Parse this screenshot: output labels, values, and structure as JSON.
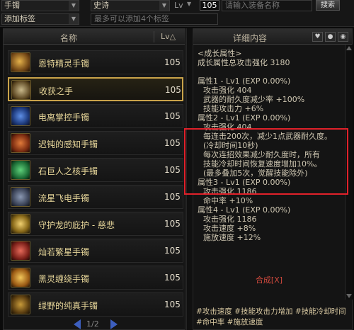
{
  "filters": {
    "type_select": "手镯",
    "rarity_select": "史诗",
    "lv_label": "Lv",
    "level_value": "105",
    "name_placeholder": "请输入装备名称",
    "search_label": "搜索",
    "tag_select": "添加标签",
    "tag_placeholder": "最多可以添加4个标签"
  },
  "list": {
    "col_name": "名称",
    "col_lv": "Lv△",
    "selected_index": 1,
    "items": [
      {
        "name": "恩特精灵手镯",
        "lv": "105"
      },
      {
        "name": "收获之手",
        "lv": "105"
      },
      {
        "name": "电离掌控手镯",
        "lv": "105"
      },
      {
        "name": "迟钝的感知手镯",
        "lv": "105"
      },
      {
        "name": "石巨人之核手镯",
        "lv": "105"
      },
      {
        "name": "流星飞电手镯",
        "lv": "105"
      },
      {
        "name": "守护龙的庇护 - 慈悲",
        "lv": "105"
      },
      {
        "name": "灿若繁星手镯",
        "lv": "105"
      },
      {
        "name": "黑灵缠绕手镯",
        "lv": "105"
      },
      {
        "name": "绿野的纯真手镯",
        "lv": "105"
      }
    ],
    "page": "1/2"
  },
  "detail": {
    "title": "详细内容",
    "lines": [
      {
        "text": "<成长属性>",
        "cls": "c-grn",
        "ind": ""
      },
      {
        "text": "成长属性总攻击强化 3180",
        "cls": "c-txt",
        "ind": ""
      },
      {
        "text": "",
        "cls": "c-txt",
        "ind": ""
      },
      {
        "text": "属性1 - Lv1 (EXP 0.00%)",
        "cls": "c-head",
        "ind": ""
      },
      {
        "text": "攻击强化 404",
        "cls": "c-txt",
        "ind": "ind1"
      },
      {
        "text": "武器的耐久度减少率 +100%",
        "cls": "c-wht",
        "ind": "ind1"
      },
      {
        "text": "技能攻击力 +6%",
        "cls": "c-wht",
        "ind": "ind1"
      },
      {
        "text": "属性2 - Lv1 (EXP 0.00%)",
        "cls": "c-head",
        "ind": ""
      },
      {
        "text": "攻击强化 404",
        "cls": "c-txt",
        "ind": "ind1"
      },
      {
        "text": "每连击200次，减少1点武器耐久度。",
        "cls": "c-wht",
        "ind": "ind1"
      },
      {
        "text": "(冷却时间10秒)",
        "cls": "c-wht",
        "ind": "ind1"
      },
      {
        "text": "每次连招效果减少耐久度时，所有",
        "cls": "c-wht",
        "ind": "ind1"
      },
      {
        "text": "技能冷却时间恢复速度增加10%。",
        "cls": "c-wht",
        "ind": "ind1"
      },
      {
        "text": "(最多叠加5次，觉醒技能除外)",
        "cls": "c-wht",
        "ind": "ind1"
      },
      {
        "text": "属性3 - Lv1 (EXP 0.00%)",
        "cls": "c-head",
        "ind": ""
      },
      {
        "text": "攻击强化 1186",
        "cls": "c-txt",
        "ind": "ind1"
      },
      {
        "text": "命中率 +10%",
        "cls": "c-wht",
        "ind": "ind1"
      },
      {
        "text": "属性4 - Lv1 (EXP 0.00%)",
        "cls": "c-head",
        "ind": ""
      },
      {
        "text": "攻击强化 1186",
        "cls": "c-txt",
        "ind": "ind1"
      },
      {
        "text": "攻击速度 +8%",
        "cls": "c-wht",
        "ind": "ind1"
      },
      {
        "text": "施放速度 +12%",
        "cls": "c-wht",
        "ind": "ind1"
      }
    ],
    "compose": "合成[X]",
    "tags": [
      "#攻击速度",
      "#技能攻击力增加",
      "#技能冷却时间",
      "#命中率",
      "#施放速度"
    ]
  },
  "colors": {
    "highlight_box": "#e0212a",
    "selected_border": "#c9a34a",
    "item_name": "#e8d79a"
  }
}
